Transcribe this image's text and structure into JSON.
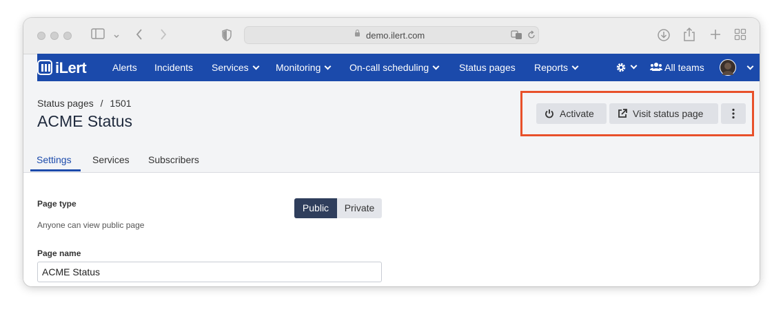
{
  "browser": {
    "url": "demo.ilert.com"
  },
  "nav": {
    "logo": "iLert",
    "items": [
      {
        "label": "Alerts"
      },
      {
        "label": "Incidents"
      },
      {
        "label": "Services"
      },
      {
        "label": "Monitoring"
      },
      {
        "label": "On-call scheduling"
      },
      {
        "label": "Status pages"
      },
      {
        "label": "Reports"
      }
    ],
    "teams_label": "All teams"
  },
  "header": {
    "breadcrumb_parent": "Status pages",
    "breadcrumb_sep": "/",
    "breadcrumb_id": "1501",
    "title": "ACME Status",
    "activate_label": "Activate",
    "visit_label": "Visit status page"
  },
  "tabs": [
    {
      "label": "Settings",
      "active": true
    },
    {
      "label": "Services",
      "active": false
    },
    {
      "label": "Subscribers",
      "active": false
    }
  ],
  "form": {
    "page_type_label": "Page type",
    "page_type_help": "Anyone can view public page",
    "page_type_options": [
      "Public",
      "Private"
    ],
    "page_type_selected": "Public",
    "page_name_label": "Page name",
    "page_name_value": "ACME Status"
  },
  "colors": {
    "nav_bg": "#1b4aab",
    "highlight": "#e8502a",
    "selected_segment": "#2f3e5c"
  }
}
